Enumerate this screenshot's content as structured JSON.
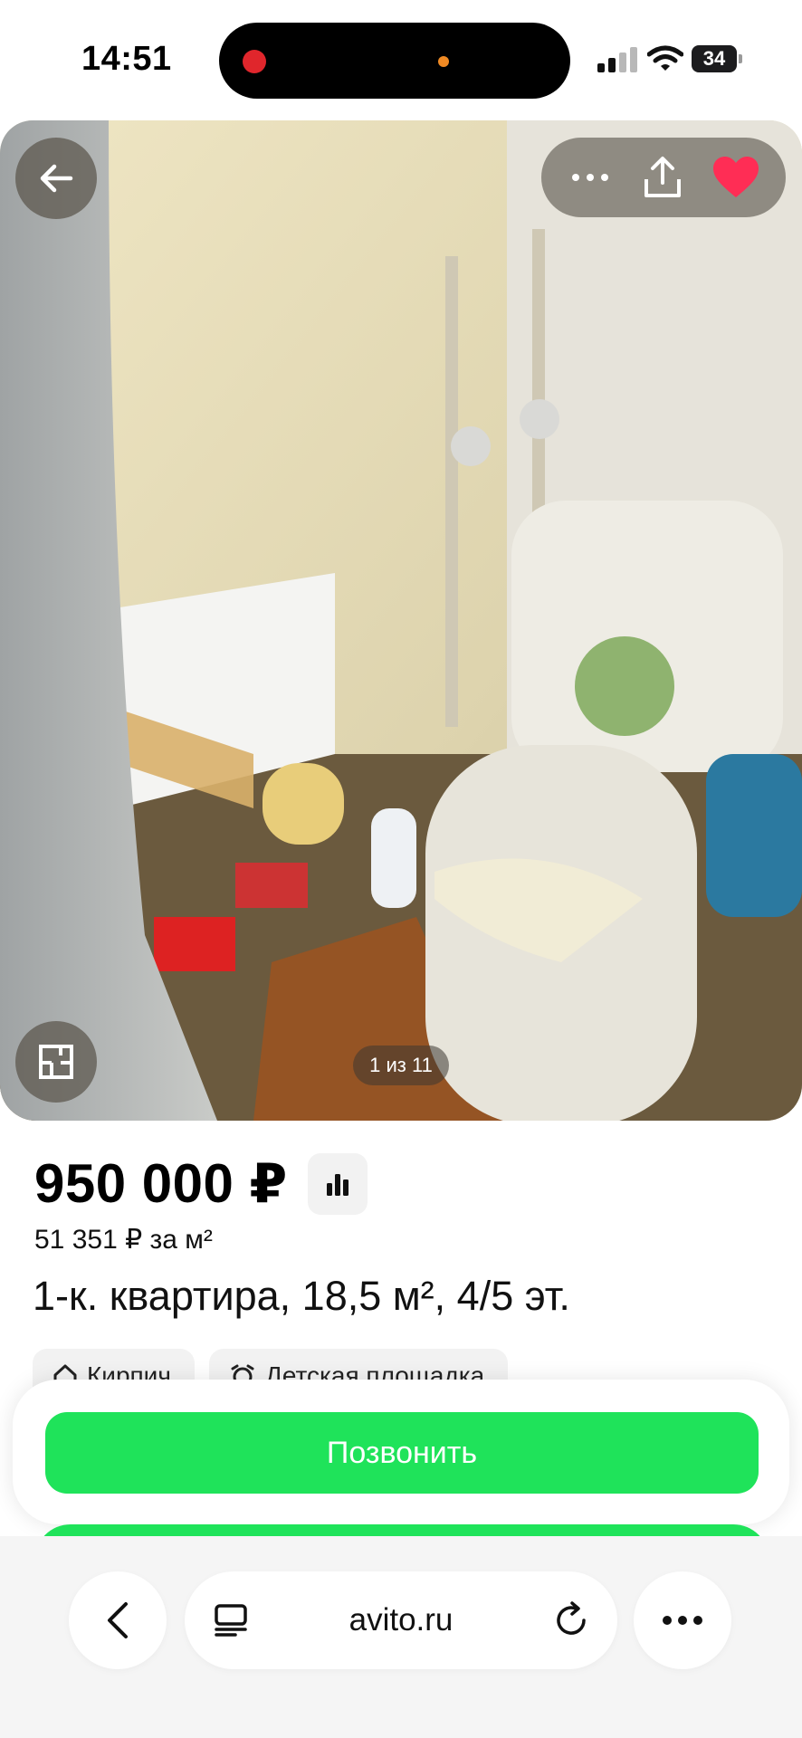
{
  "status_bar": {
    "time": "14:51",
    "battery": "34"
  },
  "gallery": {
    "counter": "1 из 11"
  },
  "listing": {
    "price": "950 000 ₽",
    "price_per_m2": "51 351 ₽ за м²",
    "title": "1-к. квартира, 18,5 м², 4/5 эт.",
    "chips": [
      "Кирпич",
      "Детская площадка"
    ]
  },
  "actions": {
    "call": "Позвонить"
  },
  "browser": {
    "url": "avito.ru"
  },
  "colors": {
    "call_green": "#1fe35a",
    "favorite_red": "#ff2d55"
  },
  "icons": [
    "back-arrow-icon",
    "more-dots-icon",
    "share-icon",
    "heart-icon",
    "floor-plan-icon",
    "stats-icon",
    "house-icon",
    "playground-icon",
    "chevron-left-icon",
    "tabs-icon",
    "reload-icon"
  ]
}
